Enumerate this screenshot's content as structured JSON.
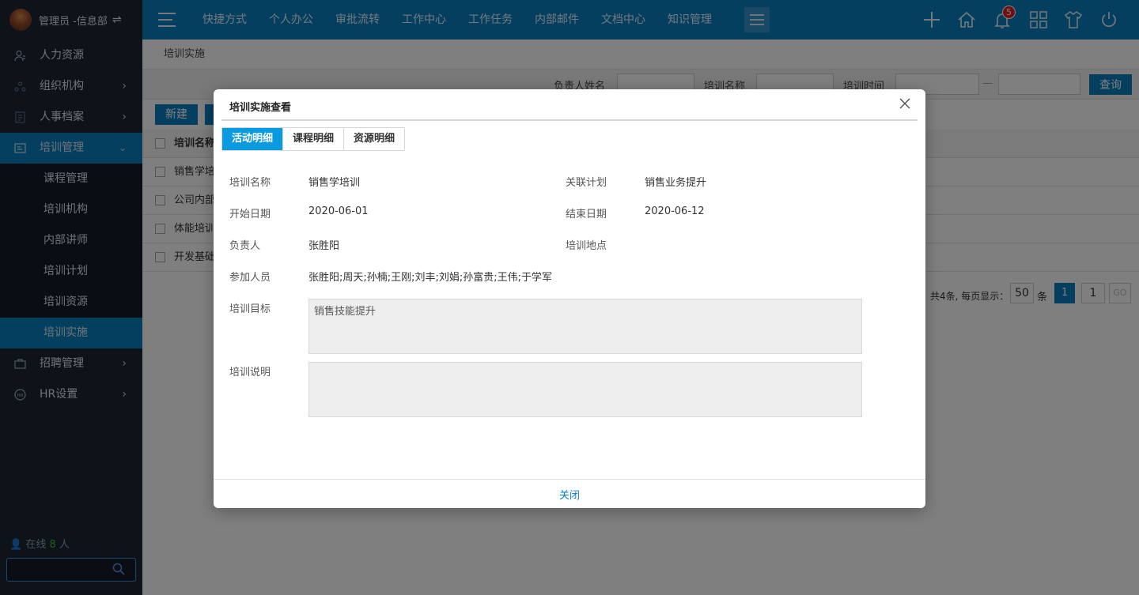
{
  "header": {
    "user": "管理员 -信息部",
    "nav": [
      "快捷方式",
      "个人办公",
      "审批流转",
      "工作中心",
      "工作任务",
      "内部邮件",
      "文档中心",
      "知识管理"
    ],
    "notification_count": "5",
    "icons": [
      "plus-icon",
      "home-icon",
      "bell-icon",
      "apps-icon",
      "skin-icon",
      "power-icon"
    ]
  },
  "sidebar": {
    "items": [
      {
        "label": "人力资源",
        "icon": "person-icon"
      },
      {
        "label": "组织机构",
        "icon": "org-icon"
      },
      {
        "label": "人事档案",
        "icon": "file-icon"
      },
      {
        "label": "培训管理",
        "icon": "training-icon"
      },
      {
        "label": "招聘管理",
        "icon": "briefcase-icon"
      },
      {
        "label": "HR设置",
        "icon": "hr-settings-icon"
      }
    ],
    "sub_items": [
      "课程管理",
      "培训机构",
      "内部讲师",
      "培训计划",
      "培训资源",
      "培训实施"
    ],
    "online_label": "在线",
    "online_count": "8",
    "online_unit": "人"
  },
  "main": {
    "breadcrumb": "培训实施",
    "filters": {
      "owner_label": "负责人姓名",
      "name_label": "培训名称",
      "time_label": "培训时间",
      "dash": "—",
      "query_button": "查询"
    },
    "toolbar": {
      "new_button": "新建"
    },
    "table": {
      "header": "培训名称",
      "rows": [
        "销售学培训",
        "公司内部",
        "体能培训",
        "开发基础"
      ]
    },
    "pager": {
      "total": "共4条, 每页显示：",
      "page_size": "50",
      "unit": "条",
      "current_page": "1",
      "goto_value": "1",
      "go_button": "GO"
    }
  },
  "modal": {
    "title": "培训实施查看",
    "tabs": [
      "活动明细",
      "课程明细",
      "资源明细"
    ],
    "active_tab": 0,
    "fields": {
      "name_label": "培训名称",
      "name_value": "销售学培训",
      "plan_label": "关联计划",
      "plan_value": "销售业务提升",
      "start_label": "开始日期",
      "start_value": "2020-06-01",
      "end_label": "结束日期",
      "end_value": "2020-06-12",
      "owner_label": "负责人",
      "owner_value": "张胜阳",
      "place_label": "培训地点",
      "place_value": "",
      "members_label": "参加人员",
      "members_value": "张胜阳;周天;孙楠;王刚;刘丰;刘娟;孙富贵;王伟;于学军",
      "goal_label": "培训目标",
      "goal_value": "销售技能提升",
      "desc_label": "培训说明",
      "desc_value": ""
    },
    "close_link": "关闭"
  }
}
